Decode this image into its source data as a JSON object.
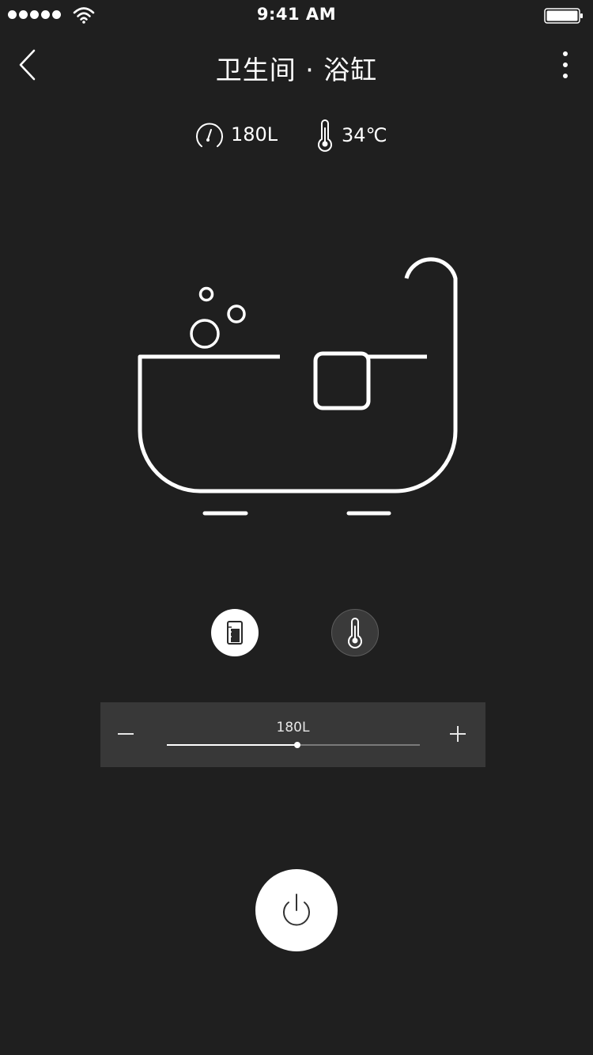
{
  "status_bar": {
    "time": "9:41 AM",
    "signal_icon": "signal-dots-icon",
    "wifi_icon": "wifi-icon",
    "battery_icon": "battery-icon"
  },
  "nav": {
    "title": "卫生间 · 浴缸",
    "back_icon": "chevron-left-icon",
    "more_icon": "more-vertical-icon"
  },
  "stats": {
    "volume": "180L",
    "volume_icon": "gauge-icon",
    "temperature": "34℃",
    "temperature_icon": "thermometer-icon"
  },
  "illustration": {
    "icon": "bathtub-icon"
  },
  "modes": [
    {
      "name": "volume",
      "icon": "water-level-icon",
      "active": true
    },
    {
      "name": "temperature",
      "icon": "thermometer-icon",
      "active": false
    }
  ],
  "slider": {
    "value_label": "180L",
    "level": 0.515,
    "minus_icon": "minus-icon",
    "plus_icon": "plus-icon"
  },
  "power": {
    "icon": "power-icon"
  },
  "colors": {
    "background": "#1f1f1f",
    "panel": "#383838",
    "foreground": "#ffffff",
    "track": "#7a7a7a"
  }
}
